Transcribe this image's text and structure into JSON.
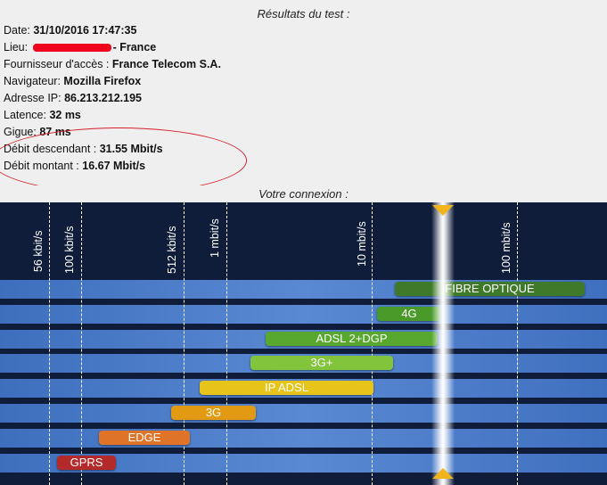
{
  "results": {
    "title": "Résultats du test :",
    "date_label": "Date: ",
    "date_value": "31/10/2016 17:47:35",
    "lieu_label": "Lieu: ",
    "lieu_value": "- France",
    "fournisseur_label": "Fournisseur d'accès : ",
    "fournisseur_value": "France Telecom S.A.",
    "navigateur_label": "Navigateur: ",
    "navigateur_value": "Mozilla Firefox",
    "ip_label": "Adresse IP: ",
    "ip_value": "86.213.212.195",
    "latence_label": "Latence: ",
    "latence_value": "32 ms",
    "gigue_label": "Gigue: ",
    "gigue_value": "87 ms",
    "descendant_label": "Débit descendant : ",
    "descendant_value": "31.55 Mbit/s",
    "montant_label": "Débit montant : ",
    "montant_value": "16.67 Mbit/s"
  },
  "connexion": {
    "title": "Votre connexion :",
    "ticks": [
      "56 kbit/s",
      "100 kbit/s",
      "512 kbit/s",
      "1 mbit/s",
      "10 mbit/s",
      "100 mbit/s"
    ],
    "technologies": [
      "FIBRE OPTIQUE",
      "4G",
      "ADSL 2+DGP",
      "3G+",
      "IP ADSL",
      "3G",
      "EDGE",
      "GPRS"
    ],
    "colors": {
      "fibre": "#3f7a2a",
      "4g": "#4a9a2a",
      "adsl2": "#58a830",
      "3gplus": "#82c43c",
      "ipadsl": "#e6c419",
      "3g": "#e29a12",
      "edge": "#df7428",
      "gprs": "#b42a2a",
      "marker": "#f2b41c"
    }
  }
}
